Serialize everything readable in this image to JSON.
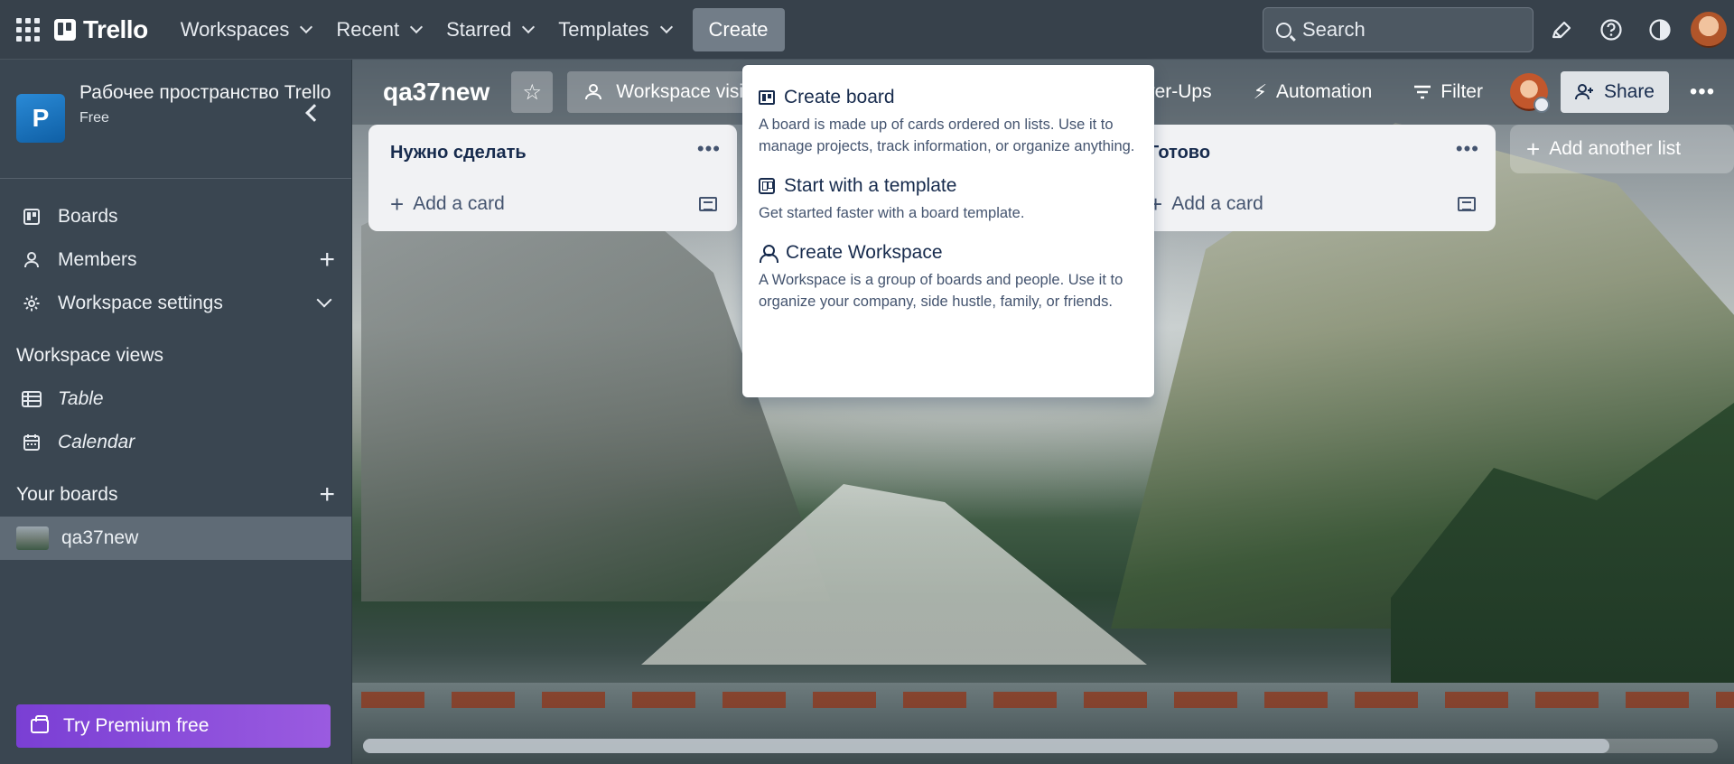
{
  "topnav": {
    "brand": "Trello",
    "menus": [
      {
        "label": "Workspaces"
      },
      {
        "label": "Recent"
      },
      {
        "label": "Starred"
      },
      {
        "label": "Templates"
      }
    ],
    "create_label": "Create",
    "search_placeholder": "Search"
  },
  "sidebar": {
    "workspace_initial": "P",
    "workspace_name": "Рабочее пространство Trello",
    "workspace_plan": "Free",
    "items": [
      {
        "label": "Boards",
        "icon": "board-icon"
      },
      {
        "label": "Members",
        "icon": "person-icon"
      },
      {
        "label": "Workspace settings",
        "icon": "gear-icon"
      }
    ],
    "views_heading": "Workspace views",
    "views": [
      {
        "label": "Table",
        "icon": "table-icon"
      },
      {
        "label": "Calendar",
        "icon": "calendar-icon"
      }
    ],
    "boards_heading": "Your boards",
    "boards": [
      {
        "label": "qa37new"
      }
    ],
    "premium_label": "Try Premium free"
  },
  "board": {
    "title": "qa37new",
    "visibility_label": "Workspace visible",
    "powerups_label": "Power-Ups",
    "automation_label": "Automation",
    "filter_label": "Filter",
    "share_label": "Share",
    "lists": [
      {
        "title": "Нужно сделать",
        "add_card": "Add a card"
      },
      {
        "title": "Готово",
        "add_card": "Add a card"
      }
    ],
    "add_list_label": "Add another list"
  },
  "create_menu": {
    "items": [
      {
        "title": "Create board",
        "desc": "A board is made up of cards ordered on lists. Use it to manage projects, track information, or organize anything."
      },
      {
        "title": "Start with a template",
        "desc": "Get started faster with a board template."
      },
      {
        "title": "Create Workspace",
        "desc": "A Workspace is a group of boards and people. Use it to organize your company, side hustle, family, or friends."
      }
    ]
  },
  "colors": {
    "topbar": "#37414b",
    "sidebar": "#3a4651",
    "premium": "#8a4fdc",
    "workspace_badge": "#1a74c2"
  }
}
